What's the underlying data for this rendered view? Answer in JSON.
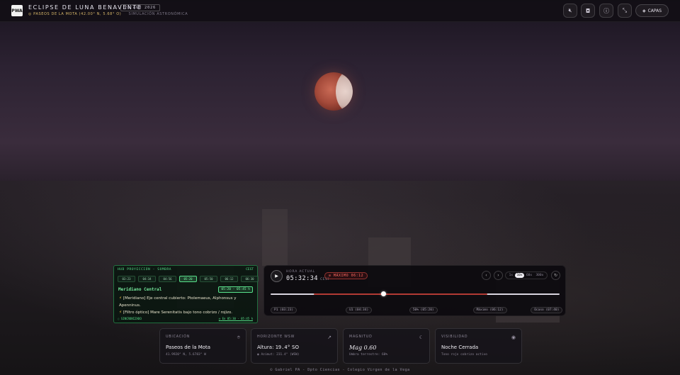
{
  "header": {
    "logo": "PWA",
    "title": "ECLIPSE DE LUNA BENAVENTE",
    "date": "28 AGO 2026",
    "location": "PASEOS DE LA MOTA (42.00° N, 5.68° O)",
    "mode": "SIMULACIÓN ASTRONÓMICA",
    "layers_label": "CAPAS"
  },
  "hud": {
    "title": "HUD PROYECCIÓN - SOMBRA",
    "timezone": "CEST",
    "times": [
      "03:23",
      "04:34",
      "04:56",
      "05:20",
      "05:50",
      "06:12",
      "06:30"
    ],
    "active_time_index": 3,
    "phase": "Meridiano Central",
    "range": "05:20 - 05:45 h",
    "notes": [
      "[Meridiano] Eje central cubierto: Ptolemaeus, Alphonsus y Apenninus.",
      "[Filtro óptico] Mare Serenitatis bajo tono cobrizo / rojizo."
    ],
    "sync_label": "SINCRONIZADO",
    "window_label": "En 05:30 - 05:45 h"
  },
  "timeline": {
    "current_label": "HORA ACTUAL",
    "current_time": "05:32:34",
    "current_tz": "CEST",
    "max_label": "MÁXIMO 06:12",
    "speeds": [
      "1x",
      "10x",
      "60x",
      "300x"
    ],
    "active_speed_index": 1,
    "progress": 0.39,
    "umbra_start": 0.15,
    "umbra_end": 0.75,
    "ticks": [
      {
        "label": "P1 (03:23)",
        "pos": 0.0
      },
      {
        "label": "U1 (04:34)",
        "pos": 0.26
      },
      {
        "label": "50% (05:20)",
        "pos": 0.48
      },
      {
        "label": "Máximo (06:12)",
        "pos": 0.7
      },
      {
        "label": "Ocaso (07:40)",
        "pos": 0.9
      }
    ]
  },
  "cards": {
    "location": {
      "label": "UBICACIÓN",
      "main": "Paseos de la Mota",
      "sub": "41.9920° N, 5.6783° W"
    },
    "horizon": {
      "label": "HORIZONTE WSW",
      "main_prefix": "Altura:",
      "main_value": "19.4°",
      "main_dir": "SO",
      "sub": "Azimut: 231.4° (WSW)"
    },
    "magnitude": {
      "label": "MAGNITUD",
      "main": "Mag 0.60",
      "sub": "Umbra terrestre: 60%"
    },
    "visibility": {
      "label": "VISIBILIDAD",
      "main": "Noche Cerrada",
      "sub": "Tono rojo cobrizo activo"
    }
  },
  "footer": "© Gabriel PA - Dpto Ciencias - Colegio Virgen de la Vega"
}
